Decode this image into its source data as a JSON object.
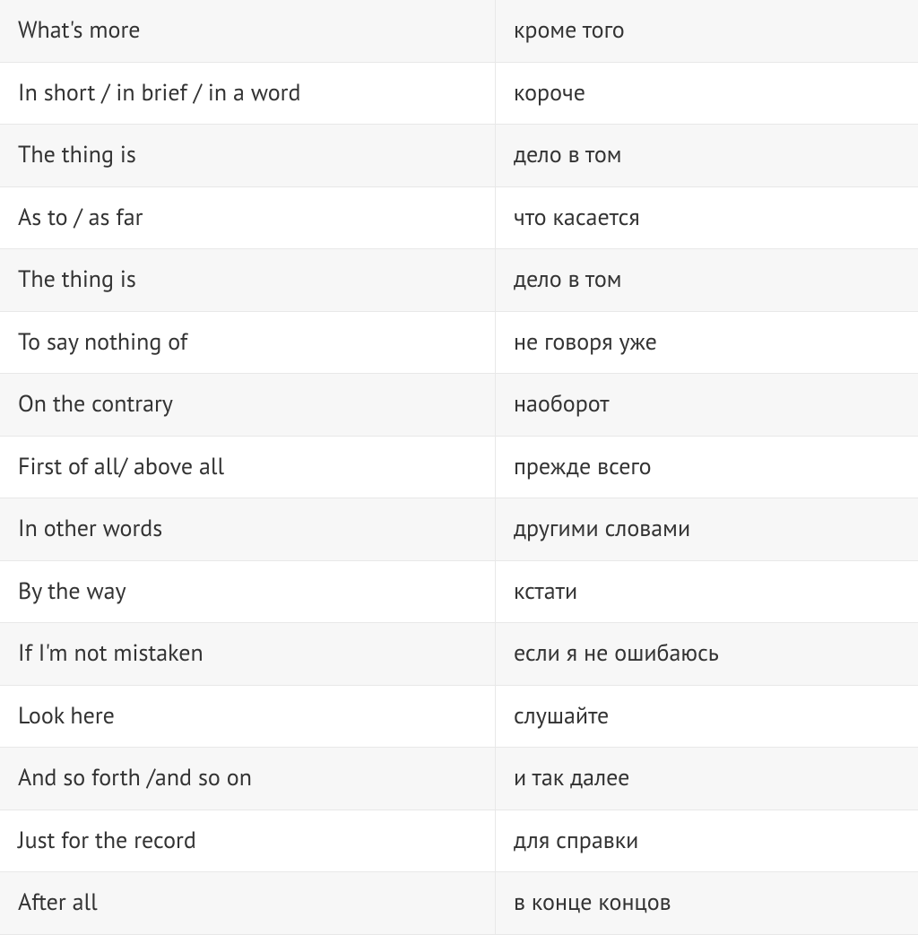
{
  "rows": [
    {
      "english": "What's more",
      "russian": "кроме того"
    },
    {
      "english": "In short / in brief / in a word",
      "russian": "короче"
    },
    {
      "english": "The thing is",
      "russian": "дело в том"
    },
    {
      "english": "As to / as far",
      "russian": "что касается"
    },
    {
      "english": "The thing is",
      "russian": "дело в том"
    },
    {
      "english": "To say nothing of",
      "russian": "не говоря уже"
    },
    {
      "english": "On the contrary",
      "russian": "наоборот"
    },
    {
      "english": "First of all/ above all",
      "russian": "прежде всего"
    },
    {
      "english": "In other words",
      "russian": "другими словами"
    },
    {
      "english": "By the way",
      "russian": "кстати"
    },
    {
      "english": "If I'm not mistaken",
      "russian": "если я не ошибаюсь"
    },
    {
      "english": "Look here",
      "russian": "слушайте"
    },
    {
      "english": "And so forth /and so on",
      "russian": "и так далее"
    },
    {
      "english": "Just for the record",
      "russian": "для справки"
    },
    {
      "english": "After all",
      "russian": "в конце концов"
    }
  ]
}
